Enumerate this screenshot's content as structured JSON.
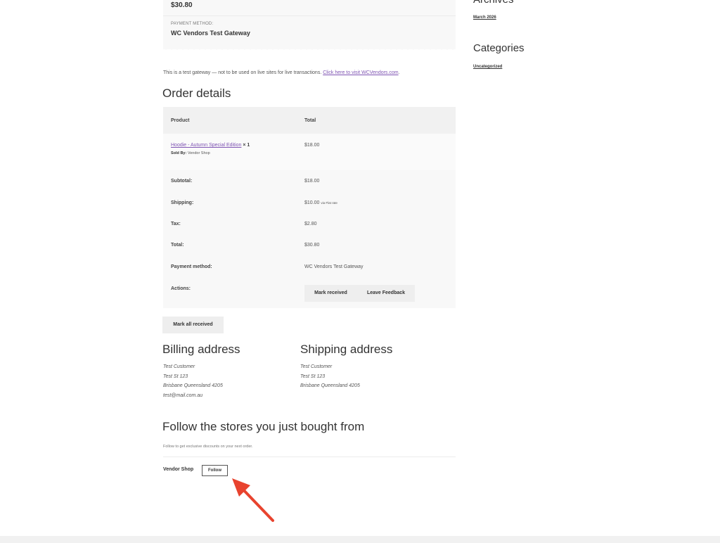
{
  "overview": {
    "total": "$30.80",
    "payment_method_label": "PAYMENT METHOD:",
    "payment_method_value": "WC Vendors Test Gateway"
  },
  "gateway_note": {
    "text": "This is a test gateway — not to be used on live sites for live transactions. ",
    "link": "Click here to visit WCVendors.com",
    "after": "."
  },
  "order_details": {
    "title": "Order details",
    "headers": {
      "product": "Product",
      "total": "Total"
    },
    "item": {
      "product": "Hoodie - Autumn Special Edition",
      "qty": "× 1",
      "sold_by_label": "Sold By:",
      "sold_by_value": "Vendor Shop",
      "total": "$18.00"
    },
    "summary": [
      {
        "label": "Subtotal:",
        "value": "$18.00",
        "note": ""
      },
      {
        "label": "Shipping:",
        "value": "$10.00",
        "note": "via Flat rate"
      },
      {
        "label": "Tax:",
        "value": "$2.80",
        "note": ""
      },
      {
        "label": "Total:",
        "value": "$30.80",
        "note": ""
      },
      {
        "label": "Payment method:",
        "value": "WC Vendors Test Gateway",
        "note": ""
      }
    ],
    "actions_label": "Actions:",
    "actions": {
      "mark_received": "Mark received",
      "leave_feedback": "Leave Feedback"
    }
  },
  "mark_all_received": "Mark all received",
  "billing": {
    "title": "Billing address",
    "lines": [
      "Test Customer",
      "Test St 123",
      "Brisbane Queensland 4205",
      "test@mail.com.au"
    ]
  },
  "shipping": {
    "title": "Shipping address",
    "lines": [
      "Test Customer",
      "Test St 123",
      "Brisbane Queensland 4205"
    ]
  },
  "follow": {
    "title": "Follow the stores you just bought from",
    "note": "Follow to get exclusive discounts on your next order.",
    "vendor": "Vendor Shop",
    "button": "Follow"
  },
  "sidebar": {
    "archives_title": "Archives",
    "archives_link": "March 2026",
    "categories_title": "Categories",
    "categories_link": "Uncategorized"
  },
  "colors": {
    "link": "#7f54b3",
    "arrow": "#e8432e",
    "table_bg": "#f8f8f8"
  }
}
